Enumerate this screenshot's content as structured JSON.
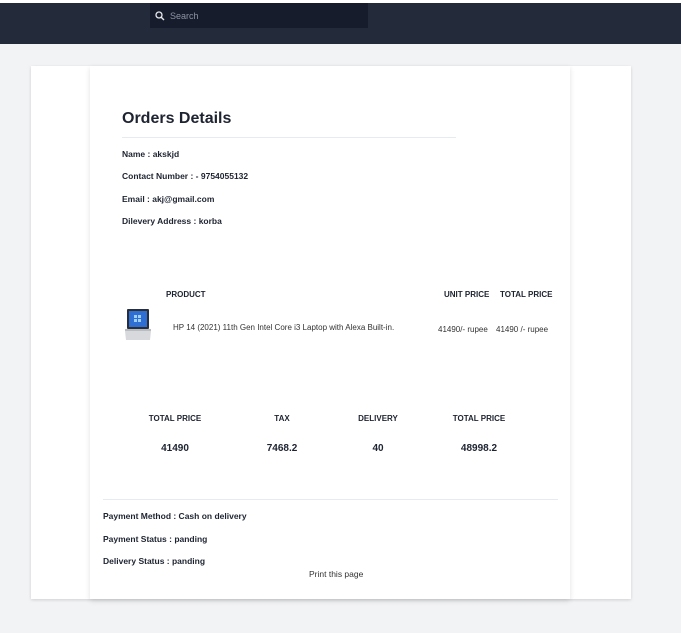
{
  "search": {
    "placeholder": "Search"
  },
  "page": {
    "title": "Orders Details"
  },
  "customer": {
    "name": "Name : akskjd",
    "contact": "Contact Number : - 9754055132",
    "email": "Email : akj@gmail.com",
    "address": "Dilevery Address : korba"
  },
  "products": {
    "headers": {
      "product": "PRODUCT",
      "unit_price": "UNIT PRICE",
      "total_price": "TOTAL PRICE"
    },
    "items": [
      {
        "image_icon": "laptop-icon",
        "name": "HP 14 (2021) 11th Gen Intel Core i3 Laptop with Alexa Built-in.",
        "unit_price": "41490/- rupee",
        "total_price": "41490 /- rupee"
      }
    ]
  },
  "summary": {
    "headers": [
      "TOTAL PRICE",
      "TAX",
      "DELIVERY",
      "TOTAL PRICE"
    ],
    "values": [
      "41490",
      "7468.2",
      "40",
      "48998.2"
    ]
  },
  "payment": {
    "method": "Payment Method : Cash on delivery",
    "status": "Payment Status : panding",
    "delivery": "Delivery Status : panding"
  },
  "actions": {
    "print_label": "Print this page"
  },
  "colors": {
    "topbar": "#232b3b",
    "search_bg": "#161c2c",
    "text": "#1d2330"
  }
}
